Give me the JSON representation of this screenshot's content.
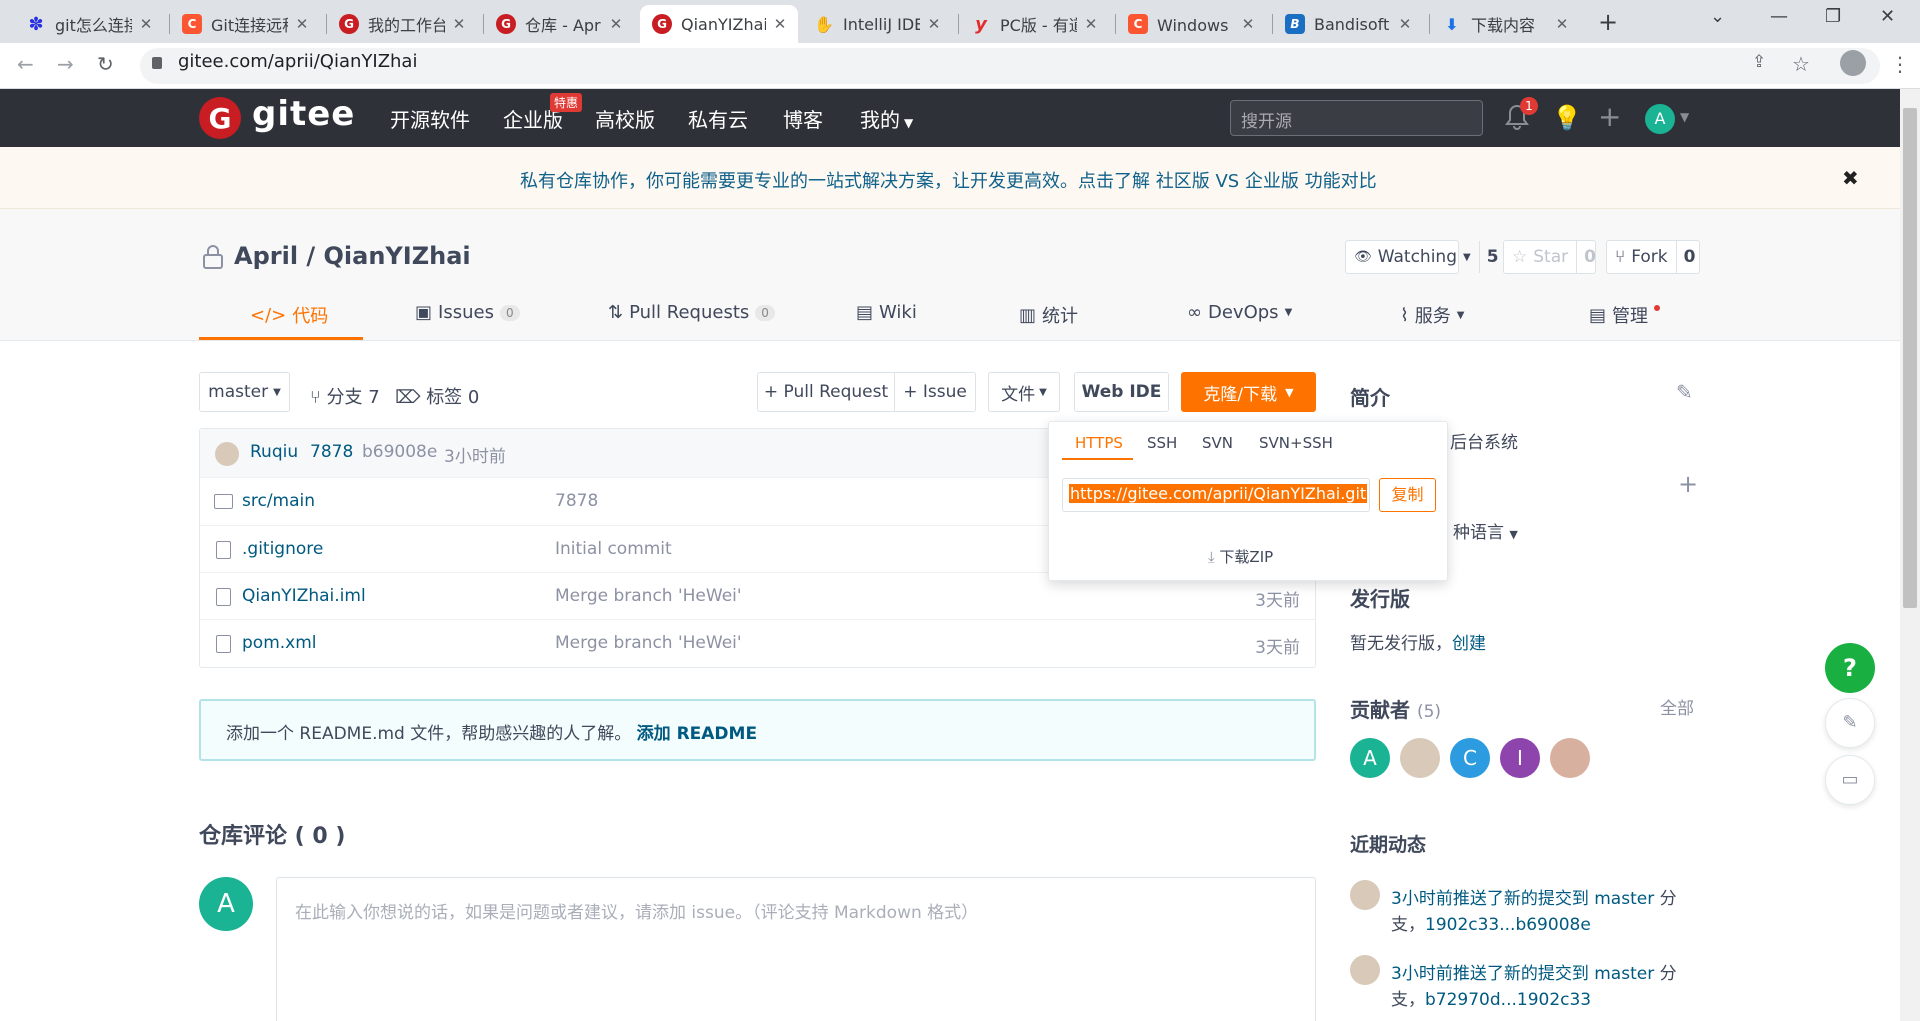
{
  "browser": {
    "tabs": [
      {
        "title": "git怎么连接",
        "icon": "baidu-icon",
        "color": "#2932e1",
        "glyph": "✽"
      },
      {
        "title": "Git连接远程",
        "icon": "csdn-icon",
        "color": "#fc5531",
        "glyph": "C"
      },
      {
        "title": "我的工作台",
        "icon": "gitee-icon",
        "color": "#c71d23",
        "glyph": "G"
      },
      {
        "title": "仓库 - April",
        "icon": "gitee-icon",
        "color": "#c71d23",
        "glyph": "G"
      },
      {
        "title": "QianYIZhai",
        "icon": "gitee-icon",
        "color": "#c71d23",
        "glyph": "G"
      },
      {
        "title": "IntelliJ IDE",
        "icon": "intellij-icon",
        "color": "#9aa0a6",
        "glyph": "✋"
      },
      {
        "title": "PC版 - 有道",
        "icon": "youdao-icon",
        "color": "#e42c2c",
        "glyph": "y"
      },
      {
        "title": "Windows 下",
        "icon": "csdn-icon",
        "color": "#fc5531",
        "glyph": "C"
      },
      {
        "title": "Bandisoft",
        "icon": "bandisoft-icon",
        "color": "#1b6fc3",
        "glyph": "B"
      },
      {
        "title": "下载内容",
        "icon": "download-icon",
        "color": "#1a73e8",
        "glyph": "⬇"
      }
    ],
    "url": "gitee.com/aprii/QianYIZhai"
  },
  "header": {
    "brand": "gitee",
    "nav": [
      "开源软件",
      "企业版",
      "高校版",
      "私有云",
      "博客",
      "我的"
    ],
    "hot_badge": "特惠",
    "search_placeholder": "搜开源",
    "notification_count": "1",
    "avatar_letter": "A"
  },
  "notice": {
    "text": "私有仓库协作，你可能需要更专业的一站式解决方案，让开发更高效。点击了解 社区版 VS 企业版 功能对比",
    "close": "✖"
  },
  "repo": {
    "owner": "April",
    "name": "QianYIZhai",
    "full_name": "April / QianYIZhai",
    "watch_label": "Watching",
    "watch_count": "5",
    "star_label": "Star",
    "star_count": "0",
    "fork_label": "Fork",
    "fork_count": "0"
  },
  "repo_tabs": [
    {
      "label": "代码",
      "badge": ""
    },
    {
      "label": "Issues",
      "badge": "0"
    },
    {
      "label": "Pull Requests",
      "badge": "0"
    },
    {
      "label": "Wiki",
      "badge": ""
    },
    {
      "label": "统计",
      "badge": ""
    },
    {
      "label": "DevOps",
      "badge": ""
    },
    {
      "label": "服务",
      "badge": ""
    },
    {
      "label": "管理",
      "badge": ""
    }
  ],
  "toolbar": {
    "branch": "master",
    "branches": "分支 7",
    "tags": "标签 0",
    "pull_request": "+ Pull Request",
    "issue": "+ Issue",
    "file": "文件",
    "web_ide": "Web IDE",
    "clone": "克隆/下载"
  },
  "commit": {
    "author": "Ruqiu",
    "message": "7878",
    "hash": "b69008e",
    "time": "3小时前"
  },
  "files": [
    {
      "name_prefix": "src/",
      "name": "main",
      "msg": "7878",
      "time": "",
      "type": "folder"
    },
    {
      "name_prefix": "",
      "name": ".gitignore",
      "msg": "Initial commit",
      "time": "",
      "type": "file"
    },
    {
      "name_prefix": "",
      "name": "QianYIZhai.iml",
      "msg": "Merge branch 'HeWei'",
      "time": "3天前",
      "type": "file"
    },
    {
      "name_prefix": "",
      "name": "pom.xml",
      "msg": "Merge branch 'HeWei'",
      "time": "3天前",
      "type": "file"
    }
  ],
  "readme": {
    "text": "添加一个 README.md 文件，帮助感兴趣的人了解。",
    "link": "添加 README"
  },
  "comments": {
    "title": "仓库评论 ( 0 )",
    "avatar_letter": "A",
    "placeholder": "在此输入你想说的话，如果是问题或者建议，请添加 issue。（评论支持 Markdown 格式）"
  },
  "clone_popup": {
    "tabs": [
      "HTTPS",
      "SSH",
      "SVN",
      "SVN+SSH"
    ],
    "url": "https://gitee.com/aprii/QianYIZhai.git",
    "copy": "复制",
    "zip": "下载ZIP"
  },
  "sidebar": {
    "intro_title": "简介",
    "intro_text": "后台系统",
    "lang_text": "种语言",
    "release_title": "发行版",
    "release_text": "暂无发行版，",
    "release_link": "创建",
    "contributors_title": "贡献者",
    "contributors_count": "(5)",
    "contributors_all": "全部",
    "contributors": [
      {
        "letter": "A",
        "color": "#1ab394"
      },
      {
        "letter": "",
        "color": "#d8c9b8"
      },
      {
        "letter": "C",
        "color": "#2d9be0"
      },
      {
        "letter": "I",
        "color": "#8e44ad"
      },
      {
        "letter": "",
        "color": "#d8b0a0"
      }
    ],
    "activity_title": "近期动态",
    "activities": [
      {
        "text": "3小时前推送了新的提交到",
        "branch": "master",
        "suffix": "分",
        "line2_prefix": "支，",
        "range": "1902c33...b69008e"
      },
      {
        "text": "3小时前推送了新的提交到",
        "branch": "master",
        "suffix": "分",
        "line2_prefix": "支，",
        "range": "b72970d...1902c33"
      }
    ]
  },
  "floating": {
    "help": "?"
  }
}
